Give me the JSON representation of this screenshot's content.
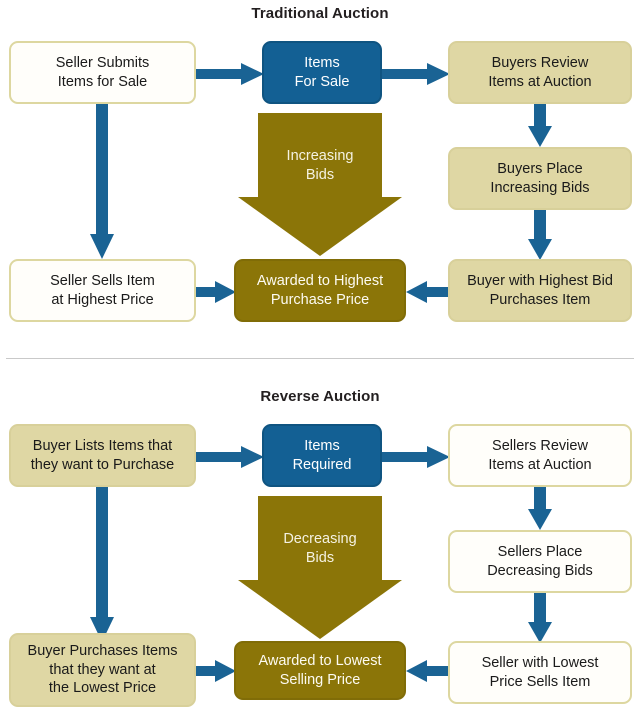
{
  "colors": {
    "blue": "#136094",
    "gold": "#8b7508",
    "khaki": "#dfd7a4",
    "khaki_border": "#ddd7a0",
    "white_box": "#fffefa",
    "text_dark": "#1a1a1a",
    "text_light": "#fdfbf2",
    "divider": "#c9c9c9",
    "background": "#ffffff"
  },
  "sections": [
    {
      "id": "traditional",
      "title": "Traditional Auction",
      "nodes": {
        "top_left": "Seller Submits\nItems for Sale",
        "top_center": "Items\nFor Sale",
        "top_right": "Buyers Review\nItems at Auction",
        "mid_right": "Buyers Place\nIncreasing Bids",
        "bottom_left": "Seller Sells Item\nat Highest Price",
        "bottom_center": "Awarded to Highest\nPurchase Price",
        "bottom_right": "Buyer with Highest Bid\nPurchases Item"
      },
      "big_arrow_label": "Increasing\nBids"
    },
    {
      "id": "reverse",
      "title": "Reverse Auction",
      "nodes": {
        "top_left": "Buyer Lists Items that\nthey want to Purchase",
        "top_center": "Items\nRequired",
        "top_right": "Sellers Review\nItems at Auction",
        "mid_right": "Sellers Place\nDecreasing Bids",
        "bottom_left": "Buyer Purchases Items\nthat they want at\nthe Lowest Price",
        "bottom_center": "Awarded to Lowest\nSelling Price",
        "bottom_right": "Seller with Lowest\nPrice Sells Item"
      },
      "big_arrow_label": "Decreasing\nBids"
    }
  ]
}
